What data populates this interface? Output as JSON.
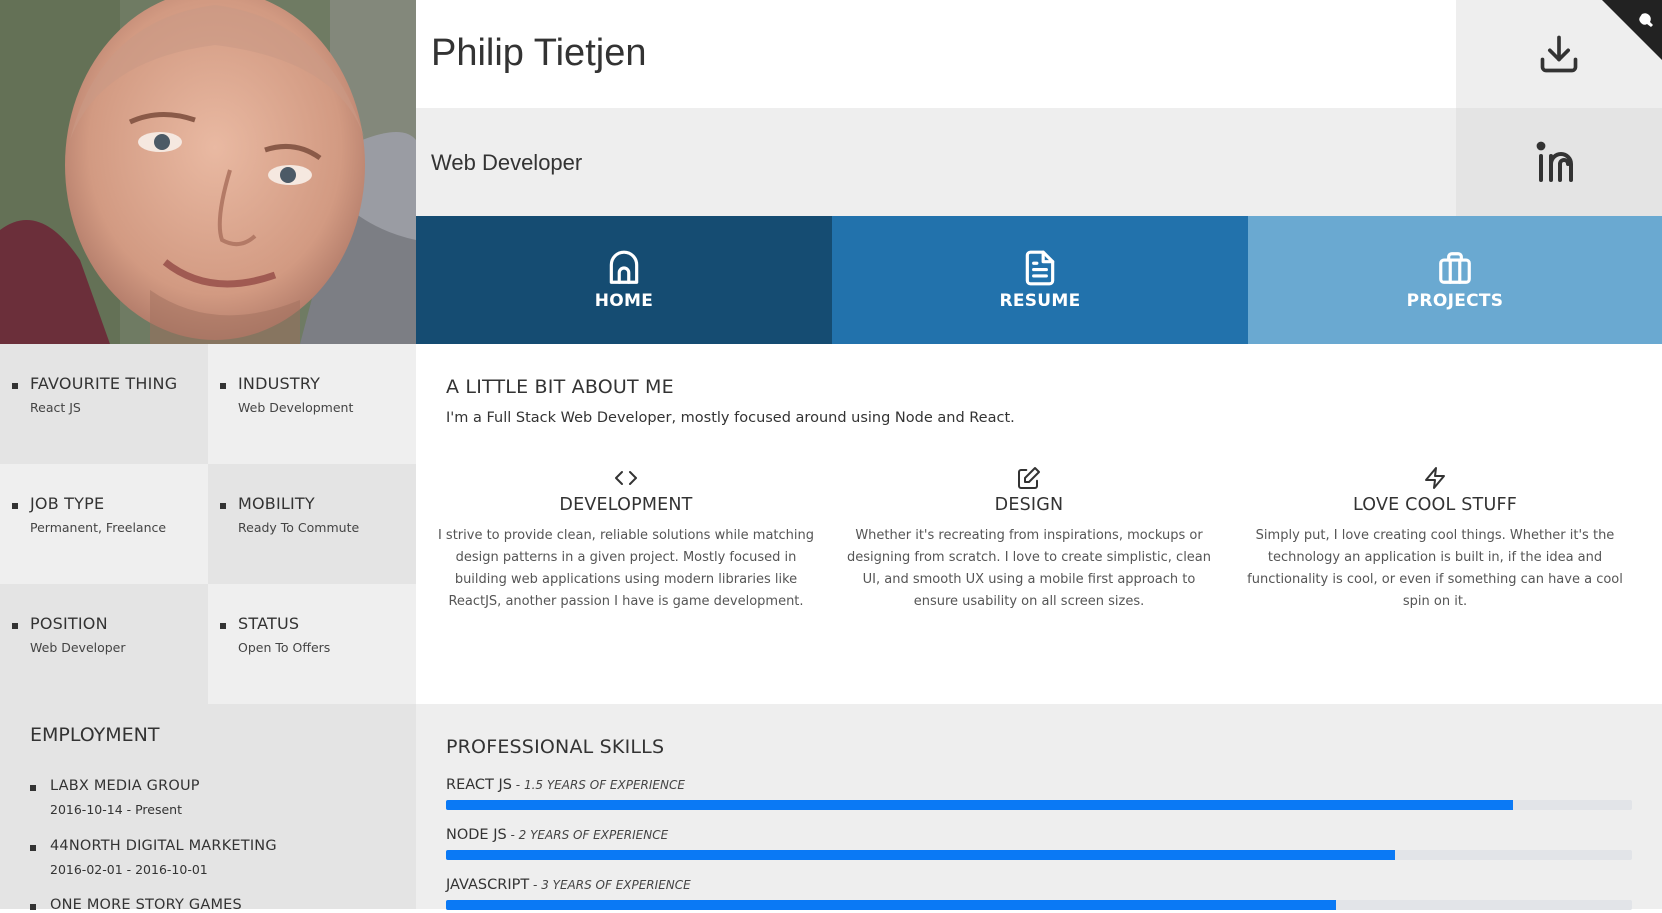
{
  "profile": {
    "name": "Philip Tietjen",
    "role": "Web Developer"
  },
  "header_icons": [
    "download-icon",
    "linkedin-icon",
    "github-corner-icon"
  ],
  "nav": [
    {
      "label": "HOME",
      "icon": "home-icon",
      "color": "#154c72",
      "active": true
    },
    {
      "label": "RESUME",
      "icon": "document-icon",
      "color": "#2272ac"
    },
    {
      "label": "PROJECTS",
      "icon": "briefcase-icon",
      "color": "#6aa9d1"
    }
  ],
  "info": [
    {
      "label": "FAVOURITE THING",
      "value": "React JS"
    },
    {
      "label": "INDUSTRY",
      "value": "Web Development"
    },
    {
      "label": "JOB TYPE",
      "value": "Permanent, Freelance"
    },
    {
      "label": "MOBILITY",
      "value": "Ready To Commute"
    },
    {
      "label": "POSITION",
      "value": "Web Developer"
    },
    {
      "label": "STATUS",
      "value": "Open To Offers"
    }
  ],
  "employment": {
    "title": "EMPLOYMENT",
    "jobs": [
      {
        "company": "LABX MEDIA GROUP",
        "dates": "2016-10-14 - Present"
      },
      {
        "company": "44NORTH DIGITAL MARKETING",
        "dates": "2016-02-01 - 2016-10-01"
      },
      {
        "company": "ONE MORE STORY GAMES",
        "dates": ""
      }
    ]
  },
  "about": {
    "title": "A LITTLE BIT ABOUT ME",
    "intro": "I'm a Full Stack Web Developer, mostly focused around using Node and React.",
    "features": [
      {
        "icon": "code-icon",
        "title": "DEVELOPMENT",
        "text": "I strive to provide clean, reliable solutions while matching design patterns in a given project. Mostly focused in building web applications using modern libraries like ReactJS, another passion I have is game development."
      },
      {
        "icon": "edit-icon",
        "title": "DESIGN",
        "text": "Whether it's recreating from inspirations, mockups or designing from scratch. I love to create simplistic, clean UI, and smooth UX using a mobile first approach to ensure usability on all screen sizes."
      },
      {
        "icon": "lightning-icon",
        "title": "LOVE COOL STUFF",
        "text": "Simply put, I love creating cool things. Whether it's the technology an application is built in, if the idea and functionality is cool, or even if something can have a cool spin on it."
      }
    ]
  },
  "skills": {
    "title": "PROFESSIONAL SKILLS",
    "items": [
      {
        "name": "REACT JS",
        "experience": "1.5 YEARS OF EXPERIENCE",
        "level": 0.9
      },
      {
        "name": "NODE JS",
        "experience": "2 YEARS OF EXPERIENCE",
        "level": 0.8
      },
      {
        "name": "JAVASCRIPT",
        "experience": "3 YEARS OF EXPERIENCE",
        "level": 0.75
      }
    ],
    "bar_color": "#0a79f5"
  }
}
